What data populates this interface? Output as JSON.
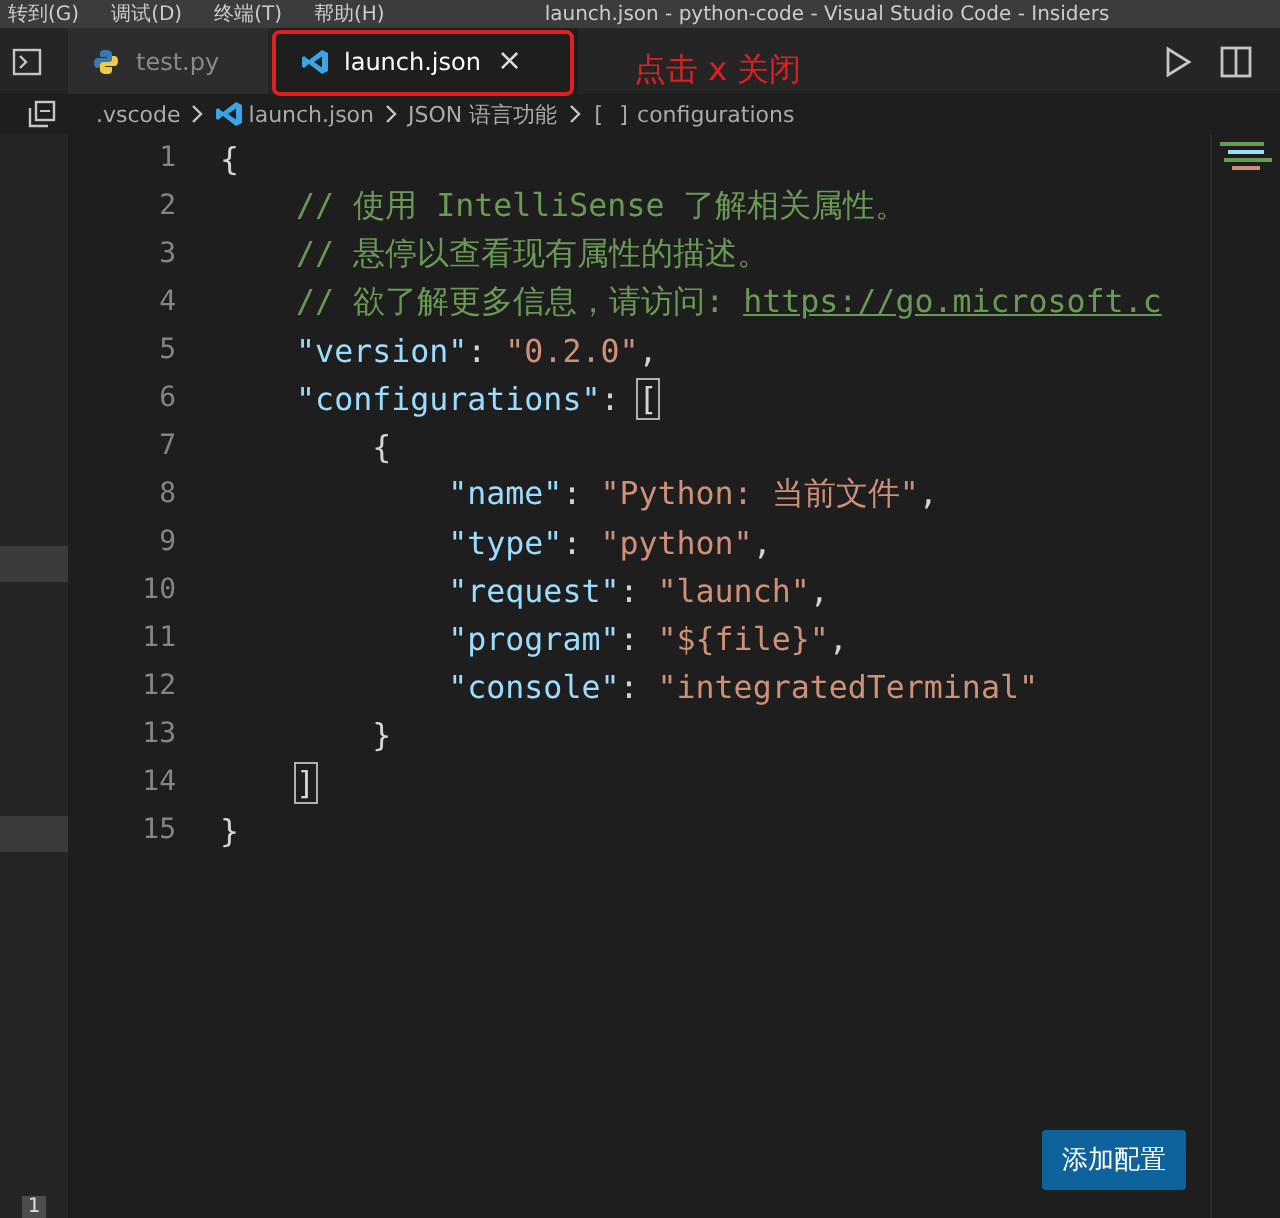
{
  "menu_bar": {
    "items": [
      "转到(G)",
      "调试(D)",
      "终端(T)",
      "帮助(H)"
    ],
    "title": "launch.json - python-code - Visual Studio Code - Insiders"
  },
  "tabs": [
    {
      "label": "test.py",
      "kind": "python",
      "selected": false
    },
    {
      "label": "launch.json",
      "kind": "vscode",
      "selected": true,
      "close": "×"
    }
  ],
  "annotation": {
    "text": "点击 x 关闭"
  },
  "breadcrumb": [
    {
      "label": ".vscode",
      "kind": "folder"
    },
    {
      "label": "launch.json",
      "kind": "vscode"
    },
    {
      "label": "JSON 语言功能",
      "kind": "plain"
    },
    {
      "label": "configurations",
      "kind": "array",
      "icon": "[ ]"
    }
  ],
  "editor": {
    "lines": [
      {
        "number": "1",
        "tokens": [
          {
            "kind": "punct",
            "text": "{"
          }
        ]
      },
      {
        "number": "2",
        "tokens": [
          {
            "kind": "comment",
            "text": "    // 使用 IntelliSense 了解相关属性。"
          }
        ]
      },
      {
        "number": "3",
        "tokens": [
          {
            "kind": "comment",
            "text": "    // 悬停以查看现有属性的描述。"
          }
        ]
      },
      {
        "number": "4",
        "tokens": [
          {
            "kind": "comment",
            "text": "    // 欲了解更多信息，请访问: "
          },
          {
            "kind": "link",
            "text": "https://go.microsoft.c"
          }
        ]
      },
      {
        "number": "5",
        "tokens": [
          {
            "kind": "key",
            "text": "    \"version\""
          },
          {
            "kind": "punct",
            "text": ": "
          },
          {
            "kind": "string",
            "text": "\"0.2.0\""
          },
          {
            "kind": "punct",
            "text": ","
          }
        ]
      },
      {
        "number": "6",
        "tokens": [
          {
            "kind": "key",
            "text": "    \"configurations\""
          },
          {
            "kind": "punct",
            "text": ": "
          },
          {
            "kind": "match",
            "text": "["
          }
        ]
      },
      {
        "number": "7",
        "tokens": [
          {
            "kind": "punct",
            "text": "        {"
          }
        ]
      },
      {
        "number": "8",
        "tokens": [
          {
            "kind": "key",
            "text": "            \"name\""
          },
          {
            "kind": "punct",
            "text": ": "
          },
          {
            "kind": "string",
            "text": "\"Python: 当前文件\""
          },
          {
            "kind": "punct",
            "text": ","
          }
        ]
      },
      {
        "number": "9",
        "tokens": [
          {
            "kind": "key",
            "text": "            \"type\""
          },
          {
            "kind": "punct",
            "text": ": "
          },
          {
            "kind": "string",
            "text": "\"python\""
          },
          {
            "kind": "punct",
            "text": ","
          }
        ]
      },
      {
        "number": "10",
        "tokens": [
          {
            "kind": "key",
            "text": "            \"request\""
          },
          {
            "kind": "punct",
            "text": ": "
          },
          {
            "kind": "string",
            "text": "\"launch\""
          },
          {
            "kind": "punct",
            "text": ","
          }
        ]
      },
      {
        "number": "11",
        "tokens": [
          {
            "kind": "key",
            "text": "            \"program\""
          },
          {
            "kind": "punct",
            "text": ": "
          },
          {
            "kind": "string",
            "text": "\"${file}\""
          },
          {
            "kind": "punct",
            "text": ","
          }
        ]
      },
      {
        "number": "12",
        "tokens": [
          {
            "kind": "key",
            "text": "            \"console\""
          },
          {
            "kind": "punct",
            "text": ": "
          },
          {
            "kind": "string",
            "text": "\"integratedTerminal\""
          }
        ]
      },
      {
        "number": "13",
        "tokens": [
          {
            "kind": "punct",
            "text": "        }"
          }
        ]
      },
      {
        "number": "14",
        "tokens": [
          {
            "kind": "match",
            "text": "    ]"
          }
        ]
      },
      {
        "number": "15",
        "tokens": [
          {
            "kind": "punct",
            "text": "}"
          }
        ]
      }
    ]
  },
  "add_config_button": "添加配置",
  "side_badge": "1"
}
